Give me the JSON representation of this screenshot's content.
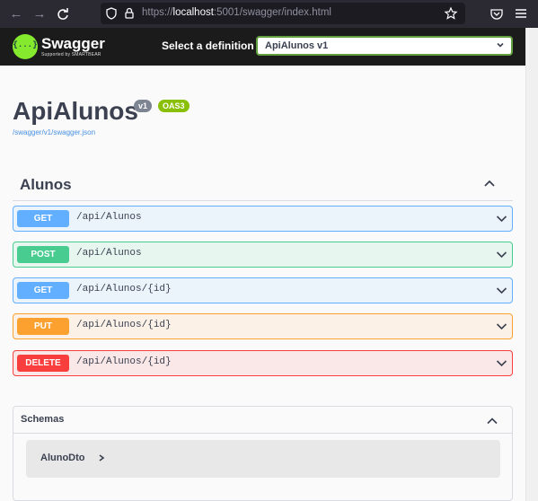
{
  "browser": {
    "url_prefix": "https://",
    "url_host": "localhost",
    "url_rest": ":5001/swagger/index.html"
  },
  "topbar": {
    "logo_text": "Swagger",
    "logo_sub": "Supported by SMARTBEAR",
    "logo_glyph": "{...}",
    "definition_label": "Select a definition",
    "definition_value": "ApiAlunos v1"
  },
  "info": {
    "title": "ApiAlunos",
    "version_badge": "v1",
    "spec_badge": "OAS3",
    "spec_link": "/swagger/v1/swagger.json"
  },
  "tag": {
    "name": "Alunos"
  },
  "operations": [
    {
      "method": "GET",
      "path": "/api/Alunos"
    },
    {
      "method": "POST",
      "path": "/api/Alunos"
    },
    {
      "method": "GET",
      "path": "/api/Alunos/{id}"
    },
    {
      "method": "PUT",
      "path": "/api/Alunos/{id}"
    },
    {
      "method": "DELETE",
      "path": "/api/Alunos/{id}"
    }
  ],
  "schemas": {
    "title": "Schemas",
    "models": [
      {
        "name": "AlunoDto"
      }
    ]
  },
  "colors": {
    "get": "#61affe",
    "post": "#49cc90",
    "put": "#fca130",
    "delete": "#f93e3e",
    "brand": "#85ea2d"
  }
}
